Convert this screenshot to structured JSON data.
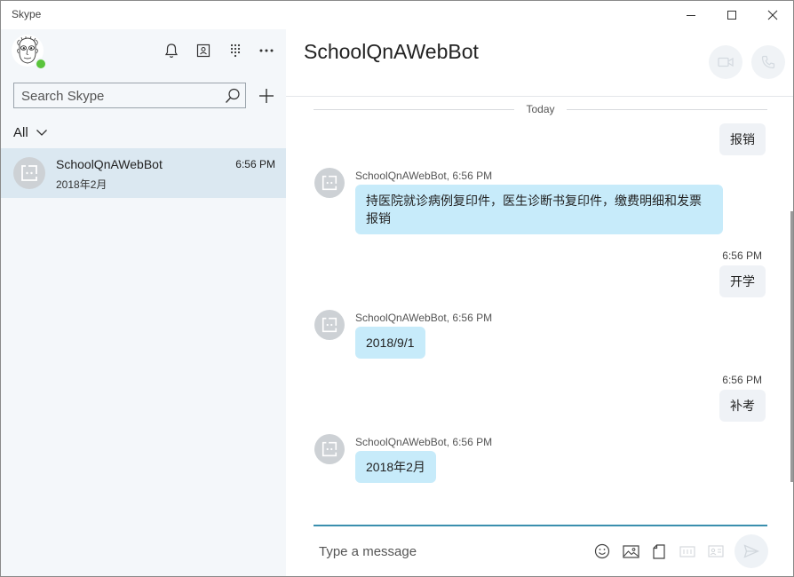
{
  "app": {
    "title": "Skype"
  },
  "sidebar": {
    "search_placeholder": "Search Skype",
    "filter_label": "All",
    "contacts": [
      {
        "name": "SchoolQnAWebBot",
        "subtitle": "2018年2月",
        "time": "6:56 PM"
      }
    ]
  },
  "chat": {
    "title": "SchoolQnAWebBot",
    "day_separator": "Today",
    "messages": [
      {
        "direction": "out",
        "text": "报销"
      },
      {
        "direction": "in",
        "sender": "SchoolQnAWebBot, 6:56 PM",
        "text": "持医院就诊病例复印件，医生诊断书复印件，缴费明细和发票报销"
      },
      {
        "direction": "out",
        "time": "6:56 PM",
        "text": "开学"
      },
      {
        "direction": "in",
        "sender": "SchoolQnAWebBot, 6:56 PM",
        "text": "2018/9/1"
      },
      {
        "direction": "out",
        "time": "6:56 PM",
        "text": "补考"
      },
      {
        "direction": "in",
        "sender": "SchoolQnAWebBot, 6:56 PM",
        "text": "2018年2月"
      }
    ],
    "compose_placeholder": "Type a message"
  },
  "colors": {
    "sidebar_bg": "#f4f7fa",
    "selected_contact_bg": "#dbe8f1",
    "incoming_bubble": "#c7ebfa",
    "outgoing_bubble": "#eff2f6",
    "presence_online": "#5ac43c",
    "compose_accent": "#3a8fae"
  },
  "icons": [
    "bell-icon",
    "contacts-icon",
    "dialpad-icon",
    "more-icon",
    "search-icon",
    "plus-icon",
    "chevron-down-icon",
    "video-call-icon",
    "audio-call-icon",
    "emoji-icon",
    "image-icon",
    "file-icon",
    "media-icon",
    "contact-card-icon",
    "send-icon"
  ]
}
